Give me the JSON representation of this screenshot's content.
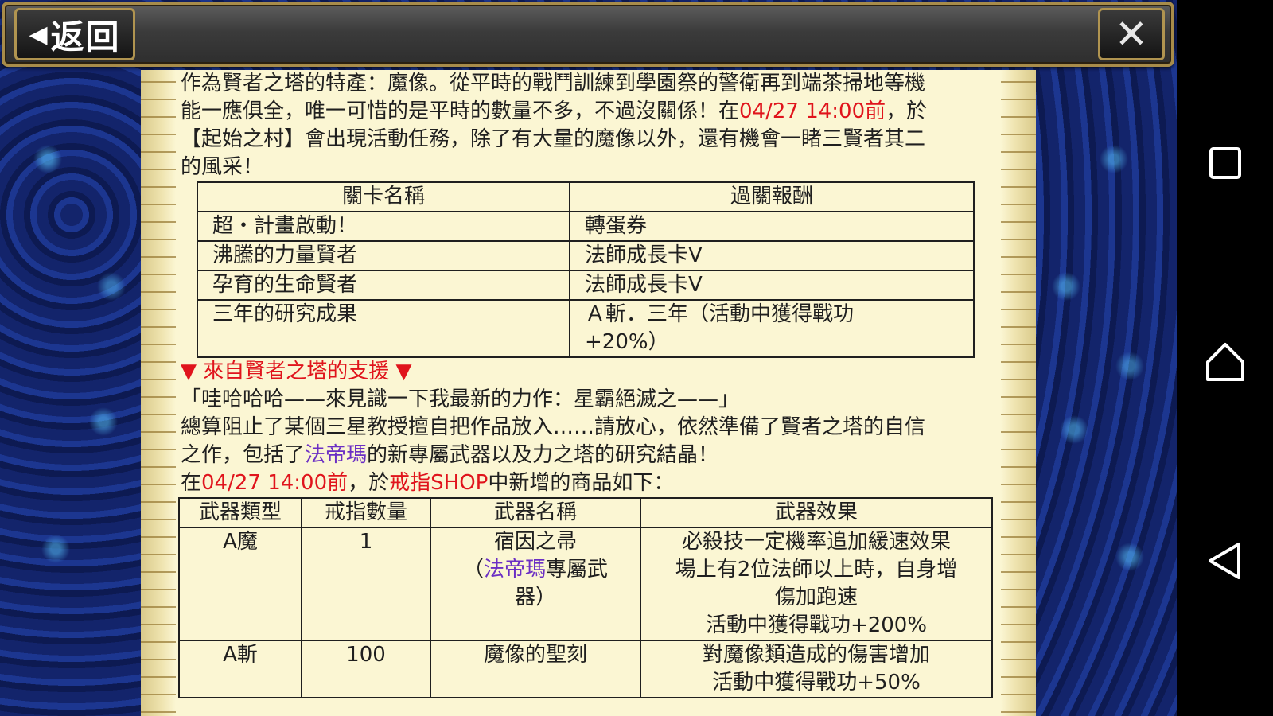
{
  "header": {
    "back_label": "返回",
    "back_arrow_icon": "triangle-left-icon",
    "close_icon": "close-x-icon"
  },
  "intro": {
    "line1": "作為賢者之塔的特產：魔像。從平時的戰鬥訓練到學園祭的警衛再到端茶掃地等機",
    "line2_a": "能一應俱全，唯一可惜的是平時的數量不多，不過沒關係！在",
    "line2_date": "04/27 14:00前",
    "line2_b": "，於",
    "line3": "【起始之村】會出現活動任務，除了有大量的魔像以外，還有機會一睹三賢者其二",
    "line4": "的風采！"
  },
  "stage_table": {
    "headers": [
      "關卡名稱",
      "過關報酬"
    ],
    "rows": [
      {
        "name": "超・計畫啟動！",
        "reward": "轉蛋券"
      },
      {
        "name": "沸騰的力量賢者",
        "reward": "法師成長卡V"
      },
      {
        "name": "孕育的生命賢者",
        "reward": "法師成長卡V"
      },
      {
        "name": "三年的研究成果",
        "reward_line1": "Ａ斬．三年（活動中獲得戰功",
        "reward_line2": "+20%）"
      }
    ]
  },
  "support": {
    "heading": "▼ 來自賢者之塔的支援 ▼",
    "quote": "「哇哈哈哈——來見識一下我最新的力作：星霸絕滅之——」",
    "para_line1": "總算阻止了某個三星教授擅自把作品放入……請放心，依然準備了賢者之塔的自信",
    "para_line2_a": "之作，包括了",
    "para_line2_name": "法帝瑪",
    "para_line2_b": "的新專屬武器以及力之塔的研究結晶！",
    "shop_a": "在",
    "shop_date": "04/27 14:00前",
    "shop_b": "，於",
    "shop_name": "戒指SHOP",
    "shop_c": "中新增的商品如下："
  },
  "weapon_table": {
    "headers": [
      "武器類型",
      "戒指數量",
      "武器名稱",
      "武器效果"
    ],
    "rows": [
      {
        "type": "A魔",
        "rings": "1",
        "name_line1": "宿因之帚",
        "name_open": "（",
        "name_highlight": "法帝瑪",
        "name_rest": "專屬武",
        "name_line3": "器）",
        "effect": [
          "必殺技一定機率追加緩速效果",
          "場上有2位法師以上時，自身增",
          "傷加跑速",
          "活動中獲得戰功+200%"
        ]
      },
      {
        "type": "A斬",
        "rings": "100",
        "name_line1": "魔像的聖刻",
        "effect": [
          "對魔像類造成的傷害增加",
          "活動中獲得戰功+50%"
        ]
      }
    ]
  },
  "android_nav": {
    "recent_icon": "square-recent-apps-icon",
    "home_icon": "home-icon",
    "back_icon": "triangle-back-icon"
  },
  "colors": {
    "highlight_red": "#e0141c",
    "highlight_purple": "#6b2fc4",
    "parchment": "#fbf6d3",
    "frame_gold": "#a88c4a"
  }
}
